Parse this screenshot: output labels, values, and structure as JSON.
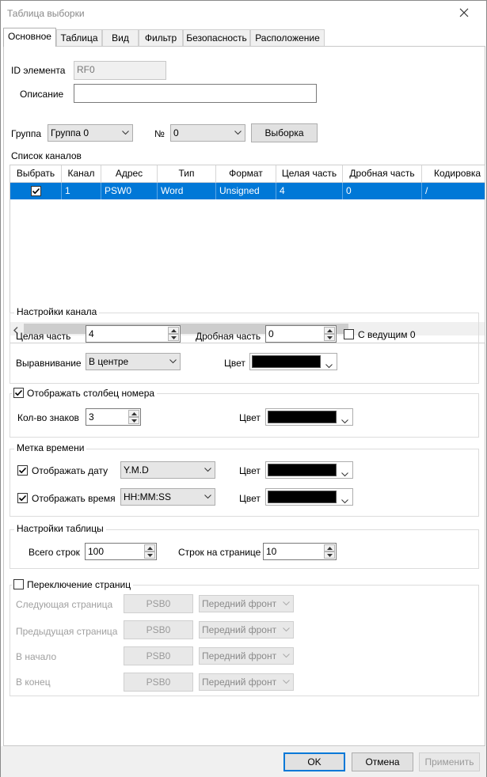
{
  "window": {
    "title": "Таблица выборки"
  },
  "tabs": [
    "Основное",
    "Таблица",
    "Вид",
    "Фильтр",
    "Безопасность",
    "Расположение"
  ],
  "element": {
    "id_label": "ID элемента",
    "id_value": "RF0",
    "desc_label": "Описание",
    "desc_value": ""
  },
  "group": {
    "label": "Группа",
    "value": "Группа 0",
    "num_label": "№",
    "num_value": "0",
    "select_button": "Выборка"
  },
  "channels": {
    "title": "Список каналов",
    "columns": [
      "Выбрать",
      "Канал",
      "Адрес",
      "Тип",
      "Формат",
      "Целая часть",
      "Дробная часть",
      "Кодировка"
    ],
    "rows": [
      {
        "checked": true,
        "channel": "1",
        "address": "PSW0",
        "type": "Word",
        "format": "Unsigned",
        "integer": "4",
        "fraction": "0",
        "encoding": "/"
      }
    ]
  },
  "channel_settings": {
    "title": "Настройки канала",
    "integer_label": "Целая часть",
    "integer_value": "4",
    "fraction_label": "Дробная часть",
    "fraction_value": "0",
    "leading_zero_label": "С ведущим 0",
    "leading_zero_checked": false,
    "align_label": "Выравнивание",
    "align_value": "В центре",
    "color_label": "Цвет",
    "color": "#000000"
  },
  "number_column": {
    "title": "Отображать столбец номера",
    "checked": true,
    "digits_label": "Кол-во знаков",
    "digits_value": "3",
    "color_label": "Цвет",
    "color": "#000000"
  },
  "timestamp": {
    "title": "Метка времени",
    "date_label": "Отображать дату",
    "date_checked": true,
    "date_format": "Y.M.D",
    "date_color_label": "Цвет",
    "time_label": "Отображать время",
    "time_checked": true,
    "time_format": "HH:MM:SS",
    "time_color_label": "Цвет",
    "color": "#000000"
  },
  "table_settings": {
    "title": "Настройки таблицы",
    "rows_label": "Всего строк",
    "rows_value": "100",
    "per_page_label": "Строк на странице",
    "per_page_value": "10"
  },
  "paging": {
    "title": "Переключение страниц",
    "checked": false,
    "items": [
      {
        "label": "Следующая страница",
        "address": "PSB0",
        "mode": "Передний фронт"
      },
      {
        "label": "Предыдущая страница",
        "address": "PSB0",
        "mode": "Передний фронт"
      },
      {
        "label": "В начало",
        "address": "PSB0",
        "mode": "Передний фронт"
      },
      {
        "label": "В конец",
        "address": "PSB0",
        "mode": "Передний фронт"
      }
    ]
  },
  "buttons": {
    "ok": "OK",
    "cancel": "Отмена",
    "apply": "Применить"
  },
  "colors": {
    "accent": "#0078d7",
    "selection": "#0078d7",
    "disabled_text": "#a0a0a0"
  }
}
